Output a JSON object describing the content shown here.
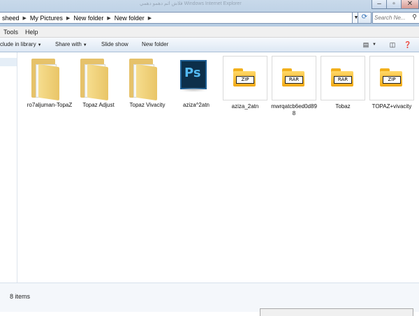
{
  "address": {
    "crumbs": [
      "sheed",
      "My Pictures",
      "New folder",
      "New folder"
    ],
    "blurred_title": "فلاش اتم دهمو دهمي   Windows Internet Explorer"
  },
  "search": {
    "placeholder": "Search Ne..."
  },
  "menu": {
    "items": [
      "Tools",
      "Help"
    ]
  },
  "toolbar": {
    "include": "clude in library",
    "share": "Share with",
    "slideshow": "Slide show",
    "newfolder": "New folder"
  },
  "files": [
    {
      "name": "ro7aljuman-TopaZ",
      "kind": "folder"
    },
    {
      "name": "Topaz Adjust",
      "kind": "folder"
    },
    {
      "name": "Topaz Vivacity",
      "kind": "folder"
    },
    {
      "name": "aziza^2atn",
      "kind": "psd"
    },
    {
      "name": "aziza_2atn",
      "kind": "zip",
      "label": "ZIP"
    },
    {
      "name": "mwrqatcb6ed0d898",
      "kind": "rar",
      "label": "RAR"
    },
    {
      "name": "Tobaz",
      "kind": "rar",
      "label": "RAR"
    },
    {
      "name": "TOPAZ+vivacity",
      "kind": "zip",
      "label": "ZIP"
    }
  ],
  "status": {
    "count": "8 items"
  },
  "colors": {
    "accent": "#2e6fb5",
    "folder": "#e9c567",
    "archive": "#f2a914"
  }
}
